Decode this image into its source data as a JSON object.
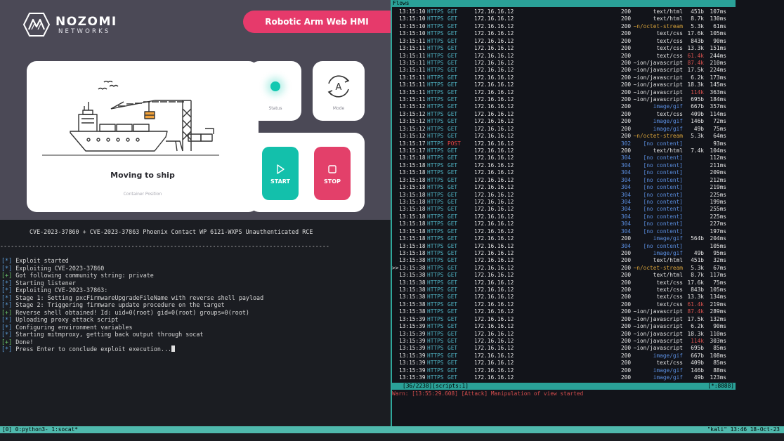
{
  "hmi": {
    "logo_name": "NOZOMI",
    "logo_sub": "NETWORKS",
    "title": "Robotic Arm Web HMI",
    "ship_state": "Moving to ship",
    "ship_sub": "Container Position",
    "status_label": "Status",
    "mode_label": "Mode",
    "mode_glyph": "A",
    "start_label": "START",
    "stop_label": "STOP",
    "accent": "#e63a6b",
    "status_color": "#13c8b1"
  },
  "terminal": {
    "banner": "CVE-2023-37860 + CVE-2023-37863 Phoenix Contact WP 6121-WXPS Unauthenticated RCE",
    "rule": "---------------------------------------------------------------------------------------------",
    "lines": [
      {
        "tag": "[*]",
        "text": "Exploit started",
        "ok": false
      },
      {
        "tag": "[*]",
        "text": "Exploiting CVE-2023-37860",
        "ok": false
      },
      {
        "tag": "[+]",
        "text": "Got following community string: private",
        "ok": true
      },
      {
        "tag": "[*]",
        "text": "Starting listener",
        "ok": false
      },
      {
        "tag": "[*]",
        "text": "Exploiting CVE-2023-37863:",
        "ok": false
      },
      {
        "tag": "[*]",
        "text": "Stage 1: Setting pxcFirmwareUpgradeFileName with reverse shell payload",
        "ok": false
      },
      {
        "tag": "[*]",
        "text": "Stage 2: Triggering firmware update procedure on the target",
        "ok": false
      },
      {
        "tag": "[+]",
        "text": "Reverse shell obtained! Id: uid=0(root) gid=0(root) groups=0(root)",
        "ok": true
      },
      {
        "tag": "[*]",
        "text": "Uploading proxy attack script",
        "ok": false
      },
      {
        "tag": "[*]",
        "text": "Configuring environment variables",
        "ok": false
      },
      {
        "tag": "[*]",
        "text": "Starting mitmproxy, getting back output through socat",
        "ok": false
      },
      {
        "tag": "[+]",
        "text": "Done!",
        "ok": true
      },
      {
        "tag": "[*]",
        "text": "Press Enter to conclude exploit execution...",
        "ok": false,
        "cursor": true
      }
    ]
  },
  "flows": {
    "header": "Flows",
    "rows": [
      {
        "cur": "",
        "time": "13:15:10",
        "proto": "HTTPS",
        "method": "GET",
        "ip": "172.16.16.12",
        "dir": "/awp/RoboticArmHMI/",
        "res": "RoboticArmH…",
        "code": "200",
        "type": "text/html",
        "size": "451b",
        "dur": "107ms"
      },
      {
        "cur": "",
        "time": "13:15:10",
        "proto": "HTTPS",
        "method": "GET",
        "ip": "172.16.16.12",
        "dir": "/Portal/",
        "res": "Portal.mwsl?PriNav=Awp",
        "code": "200",
        "type": "text/html",
        "size": "8.7k",
        "dur": "130ms"
      },
      {
        "cur": "",
        "time": "13:15:10",
        "proto": "HTTPS",
        "method": "GET",
        "ip": "172.16.16.12",
        "dir": "/",
        "res": "favicon.ico",
        "code": "200",
        "type": "~n/octet-stream",
        "tcolor": "orange",
        "size": "5.3k",
        "dur": "61ms"
      },
      {
        "cur": "",
        "time": "13:15:10",
        "proto": "HTTPS",
        "method": "GET",
        "ip": "172.16.16.12",
        "dir": "/CSS/",
        "res": "MiniWeb.css",
        "code": "200",
        "type": "text/css",
        "size": "17.6k",
        "dur": "105ms"
      },
      {
        "cur": "",
        "time": "13:15:11",
        "proto": "HTTPS",
        "method": "GET",
        "ip": "172.16.16.12",
        "dir": "/CSS/",
        "res": "TreeViewIcons.css",
        "code": "200",
        "type": "text/css",
        "size": "843b",
        "dur": "90ms"
      },
      {
        "cur": "",
        "time": "13:15:11",
        "proto": "HTTPS",
        "method": "GET",
        "ip": "172.16.16.12",
        "dir": "/CSS/",
        "res": "SpriteImages.css",
        "code": "200",
        "type": "text/css",
        "size": "13.3k",
        "dur": "151ms"
      },
      {
        "cur": "",
        "time": "13:15:11",
        "proto": "HTTPS",
        "method": "GET",
        "ip": "172.16.16.12",
        "dir": "/CSS/",
        "res": "S7Web.css",
        "code": "200",
        "type": "text/css",
        "size": "61.4k",
        "swarn": true,
        "dur": "244ms"
      },
      {
        "cur": "",
        "time": "13:15:11",
        "proto": "HTTPS",
        "method": "GET",
        "ip": "172.16.16.12",
        "dir": "/Scripts/",
        "res": "jquery.js",
        "code": "200",
        "type": "~ion/javascript",
        "size": "87.4k",
        "swarn": true,
        "dur": "210ms"
      },
      {
        "cur": "",
        "time": "13:15:11",
        "proto": "HTTPS",
        "method": "GET",
        "ip": "172.16.16.12",
        "dir": "/Scripts/",
        "res": "CommonScripts.js",
        "code": "200",
        "type": "~ion/javascript",
        "size": "17.5k",
        "dur": "224ms"
      },
      {
        "cur": "",
        "time": "13:15:11",
        "proto": "HTTPS",
        "method": "GET",
        "ip": "172.16.16.12",
        "dir": "/Scripts/",
        "res": "update.js",
        "code": "200",
        "type": "~ion/javascript",
        "size": "6.2k",
        "dur": "173ms"
      },
      {
        "cur": "",
        "time": "13:15:11",
        "proto": "HTTPS",
        "method": "GET",
        "ip": "172.16.16.12",
        "dir": "/Scripts/",
        "res": "sortfiltertablel.js",
        "code": "200",
        "type": "~ion/javascript",
        "size": "18.3k",
        "dur": "145ms"
      },
      {
        "cur": "",
        "time": "13:15:11",
        "proto": "HTTPS",
        "method": "GET",
        "ip": "172.16.16.12",
        "dir": "/Scripts/",
        "res": "topo.js",
        "code": "200",
        "type": "~ion/javascript",
        "size": "114k",
        "swarn": true,
        "dur": "363ms"
      },
      {
        "cur": "",
        "time": "13:15:11",
        "proto": "HTTPS",
        "method": "GET",
        "ip": "172.16.16.12",
        "dir": "/Scripts/",
        "res": "popup.js",
        "code": "200",
        "type": "~ion/javascript",
        "size": "695b",
        "dur": "184ms"
      },
      {
        "cur": "",
        "time": "13:15:12",
        "proto": "HTTPS",
        "method": "GET",
        "ip": "172.16.16.12",
        "dir": "/Images/",
        "res": "Siemens_Firmenmarke.gif",
        "code": "200",
        "type": "image/gif",
        "tcolor": "blue",
        "size": "667b",
        "dur": "357ms"
      },
      {
        "cur": "",
        "time": "13:15:12",
        "proto": "HTTPS",
        "method": "GET",
        "ip": "172.16.16.12",
        "dir": "/CSS/",
        "res": "MiniWebPrint.css",
        "code": "200",
        "type": "text/css",
        "size": "409b",
        "dur": "114ms"
      },
      {
        "cur": "",
        "time": "13:15:12",
        "proto": "HTTPS",
        "method": "GET",
        "ip": "172.16.16.12",
        "dir": "/Images/",
        "res": "background.gif",
        "code": "200",
        "type": "image/gif",
        "tcolor": "blue",
        "size": "146b",
        "dur": "72ms"
      },
      {
        "cur": "",
        "time": "13:15:12",
        "proto": "HTTPS",
        "method": "GET",
        "ip": "172.16.16.12",
        "dir": "/Images/",
        "res": "NaviPfeilweiss.gif",
        "code": "200",
        "type": "image/gif",
        "tcolor": "blue",
        "size": "49b",
        "dur": "75ms"
      },
      {
        "cur": "",
        "time": "13:15:12",
        "proto": "HTTPS",
        "method": "GET",
        "ip": "172.16.16.12",
        "dir": "/",
        "res": "favicon.ico",
        "code": "200",
        "type": "~n/octet-stream",
        "tcolor": "orange",
        "size": "5.3k",
        "dur": "64ms"
      },
      {
        "cur": "",
        "time": "13:15:17",
        "proto": "HTTPS",
        "method": "POST",
        "post": true,
        "ip": "172.16.16.12",
        "dir": "/FormLogin",
        "res": "",
        "code": "302",
        "cnc": true,
        "type": "[no content]",
        "tcolor": "blue",
        "size": "",
        "dur": "93ms"
      },
      {
        "cur": "",
        "time": "13:15:17",
        "proto": "HTTPS",
        "method": "GET",
        "ip": "172.16.16.12",
        "dir": "/Portal/",
        "res": "Portal.mwsl?PriNav=Awp",
        "code": "200",
        "type": "text/html",
        "size": "7.4k",
        "dur": "104ms"
      },
      {
        "cur": "",
        "time": "13:15:18",
        "proto": "HTTPS",
        "method": "GET",
        "ip": "172.16.16.12",
        "dir": "/CSS/",
        "res": "MiniWeb.css",
        "code": "304",
        "cnc": true,
        "type": "[no content]",
        "tcolor": "blue",
        "size": "",
        "dur": "112ms"
      },
      {
        "cur": "",
        "time": "13:15:18",
        "proto": "HTTPS",
        "method": "GET",
        "ip": "172.16.16.12",
        "dir": "/CSS/",
        "res": "TreeViewIcons.css",
        "code": "304",
        "cnc": true,
        "type": "[no content]",
        "tcolor": "blue",
        "size": "",
        "dur": "211ms"
      },
      {
        "cur": "",
        "time": "13:15:18",
        "proto": "HTTPS",
        "method": "GET",
        "ip": "172.16.16.12",
        "dir": "/CSS/",
        "res": "SpriteImages.css",
        "code": "304",
        "cnc": true,
        "type": "[no content]",
        "tcolor": "blue",
        "size": "",
        "dur": "209ms"
      },
      {
        "cur": "",
        "time": "13:15:18",
        "proto": "HTTPS",
        "method": "GET",
        "ip": "172.16.16.12",
        "dir": "/CSS/",
        "res": "S7Web.css",
        "code": "304",
        "cnc": true,
        "type": "[no content]",
        "tcolor": "blue",
        "size": "",
        "dur": "212ms"
      },
      {
        "cur": "",
        "time": "13:15:18",
        "proto": "HTTPS",
        "method": "GET",
        "ip": "172.16.16.12",
        "dir": "/Scripts/",
        "res": "jquery.js",
        "code": "304",
        "cnc": true,
        "type": "[no content]",
        "tcolor": "blue",
        "size": "",
        "dur": "219ms"
      },
      {
        "cur": "",
        "time": "13:15:18",
        "proto": "HTTPS",
        "method": "GET",
        "ip": "172.16.16.12",
        "dir": "/Scripts/",
        "res": "CommonScripts.js",
        "code": "304",
        "cnc": true,
        "type": "[no content]",
        "tcolor": "blue",
        "size": "",
        "dur": "225ms"
      },
      {
        "cur": "",
        "time": "13:15:18",
        "proto": "HTTPS",
        "method": "GET",
        "ip": "172.16.16.12",
        "dir": "/Scripts/",
        "res": "update.js",
        "code": "304",
        "cnc": true,
        "type": "[no content]",
        "tcolor": "blue",
        "size": "",
        "dur": "199ms"
      },
      {
        "cur": "",
        "time": "13:15:18",
        "proto": "HTTPS",
        "method": "GET",
        "ip": "172.16.16.12",
        "dir": "/Scripts/",
        "res": "sortfiltertablel.js",
        "code": "304",
        "cnc": true,
        "type": "[no content]",
        "tcolor": "blue",
        "size": "",
        "dur": "255ms"
      },
      {
        "cur": "",
        "time": "13:15:18",
        "proto": "HTTPS",
        "method": "GET",
        "ip": "172.16.16.12",
        "dir": "/Scripts/",
        "res": "topo.js",
        "code": "304",
        "cnc": true,
        "type": "[no content]",
        "tcolor": "blue",
        "size": "",
        "dur": "225ms"
      },
      {
        "cur": "",
        "time": "13:15:18",
        "proto": "HTTPS",
        "method": "GET",
        "ip": "172.16.16.12",
        "dir": "/Scripts/",
        "res": "popup.js",
        "code": "304",
        "cnc": true,
        "type": "[no content]",
        "tcolor": "blue",
        "size": "",
        "dur": "227ms"
      },
      {
        "cur": "",
        "time": "13:15:18",
        "proto": "HTTPS",
        "method": "GET",
        "ip": "172.16.16.12",
        "dir": "/Images/",
        "res": "Siemens_Firmenmarke.gif",
        "code": "304",
        "cnc": true,
        "type": "[no content]",
        "tcolor": "blue",
        "size": "",
        "dur": "197ms"
      },
      {
        "cur": "",
        "time": "13:15:18",
        "proto": "HTTPS",
        "method": "GET",
        "ip": "172.16.16.12",
        "dir": "/Images/",
        "res": "ICO_WEB_refresh.gif",
        "code": "200",
        "type": "image/gif",
        "tcolor": "blue",
        "size": "564b",
        "dur": "204ms"
      },
      {
        "cur": "",
        "time": "13:15:18",
        "proto": "HTTPS",
        "method": "GET",
        "ip": "172.16.16.12",
        "dir": "/CSS/",
        "res": "MiniWebPrint.css",
        "code": "304",
        "cnc": true,
        "type": "[no content]",
        "tcolor": "blue",
        "size": "",
        "dur": "105ms"
      },
      {
        "cur": "",
        "time": "13:15:18",
        "proto": "HTTPS",
        "method": "GET",
        "ip": "172.16.16.12",
        "dir": "/Images/",
        "res": "NaviPfeilblau.gif",
        "code": "200",
        "type": "image/gif",
        "tcolor": "blue",
        "size": "49b",
        "dur": "95ms"
      },
      {
        "cur": "",
        "time": "13:15:38",
        "proto": "HTTPS",
        "method": "GET",
        "ip": "172.16.16.12",
        "dir": "/awp/RoboticArmHMI/",
        "res": "RoboticArmH…",
        "code": "200",
        "type": "text/html",
        "size": "451b",
        "dur": "32ms"
      },
      {
        "cur": ">>",
        "time": "13:15:38",
        "proto": "HTTPS",
        "method": "GET",
        "ip": "172.16.16.12",
        "dir": "/",
        "res": "favicon.ico",
        "code": "200",
        "type": "~n/octet-stream",
        "tcolor": "orange",
        "size": "5.3k",
        "dur": "67ms"
      },
      {
        "cur": "",
        "time": "13:15:38",
        "proto": "HTTPS",
        "method": "GET",
        "ip": "172.16.16.12",
        "dir": "/Portal/",
        "res": "Portal.mwsl?PriNav=Awp",
        "code": "200",
        "type": "text/html",
        "size": "8.7k",
        "dur": "117ms"
      },
      {
        "cur": "",
        "time": "13:15:38",
        "proto": "HTTPS",
        "method": "GET",
        "ip": "172.16.16.12",
        "dir": "/CSS/",
        "res": "MiniWeb.css",
        "code": "200",
        "type": "text/css",
        "size": "17.6k",
        "dur": "75ms"
      },
      {
        "cur": "",
        "time": "13:15:38",
        "proto": "HTTPS",
        "method": "GET",
        "ip": "172.16.16.12",
        "dir": "/CSS/",
        "res": "TreeViewIcons.css",
        "code": "200",
        "type": "text/css",
        "size": "843b",
        "dur": "105ms"
      },
      {
        "cur": "",
        "time": "13:15:38",
        "proto": "HTTPS",
        "method": "GET",
        "ip": "172.16.16.12",
        "dir": "/CSS/",
        "res": "SpriteImages.css",
        "code": "200",
        "type": "text/css",
        "size": "13.3k",
        "dur": "134ms"
      },
      {
        "cur": "",
        "time": "13:15:38",
        "proto": "HTTPS",
        "method": "GET",
        "ip": "172.16.16.12",
        "dir": "/CSS/",
        "res": "S7Web.css",
        "code": "200",
        "type": "text/css",
        "size": "61.4k",
        "swarn": true,
        "dur": "219ms"
      },
      {
        "cur": "",
        "time": "13:15:38",
        "proto": "HTTPS",
        "method": "GET",
        "ip": "172.16.16.12",
        "dir": "/Scripts/",
        "res": "jquery.js",
        "code": "200",
        "type": "~ion/javascript",
        "size": "87.4k",
        "swarn": true,
        "dur": "289ms"
      },
      {
        "cur": "",
        "time": "13:15:39",
        "proto": "HTTPS",
        "method": "GET",
        "ip": "172.16.16.12",
        "dir": "/Scripts/",
        "res": "CommonScripts.js",
        "code": "200",
        "type": "~ion/javascript",
        "size": "17.5k",
        "dur": "132ms"
      },
      {
        "cur": "",
        "time": "13:15:39",
        "proto": "HTTPS",
        "method": "GET",
        "ip": "172.16.16.12",
        "dir": "/Scripts/",
        "res": "update.js",
        "code": "200",
        "type": "~ion/javascript",
        "size": "6.2k",
        "dur": "90ms"
      },
      {
        "cur": "",
        "time": "13:15:39",
        "proto": "HTTPS",
        "method": "GET",
        "ip": "172.16.16.12",
        "dir": "/Scripts/",
        "res": "sortfiltertablel.js",
        "code": "200",
        "type": "~ion/javascript",
        "size": "18.3k",
        "dur": "110ms"
      },
      {
        "cur": "",
        "time": "13:15:39",
        "proto": "HTTPS",
        "method": "GET",
        "ip": "172.16.16.12",
        "dir": "/Scripts/",
        "res": "topo.js",
        "code": "200",
        "type": "~ion/javascript",
        "size": "114k",
        "swarn": true,
        "dur": "303ms"
      },
      {
        "cur": "",
        "time": "13:15:39",
        "proto": "HTTPS",
        "method": "GET",
        "ip": "172.16.16.12",
        "dir": "/Scripts/",
        "res": "popup.js",
        "code": "200",
        "type": "~ion/javascript",
        "size": "695b",
        "dur": "85ms"
      },
      {
        "cur": "",
        "time": "13:15:39",
        "proto": "HTTPS",
        "method": "GET",
        "ip": "172.16.16.12",
        "dir": "/Images/",
        "res": "Siemens_Firmenmarke.gif",
        "code": "200",
        "type": "image/gif",
        "tcolor": "blue",
        "size": "667b",
        "dur": "108ms"
      },
      {
        "cur": "",
        "time": "13:15:39",
        "proto": "HTTPS",
        "method": "GET",
        "ip": "172.16.16.12",
        "dir": "/CSS/",
        "res": "MiniWebPrint.css",
        "code": "200",
        "type": "text/css",
        "size": "409b",
        "dur": "85ms"
      },
      {
        "cur": "",
        "time": "13:15:39",
        "proto": "HTTPS",
        "method": "GET",
        "ip": "172.16.16.12",
        "dir": "/Images/",
        "res": "background.gif",
        "code": "200",
        "type": "image/gif",
        "tcolor": "blue",
        "size": "146b",
        "dur": "88ms"
      },
      {
        "cur": "",
        "time": "13:15:39",
        "proto": "HTTPS",
        "method": "GET",
        "ip": "172.16.16.12",
        "dir": "/Images/",
        "res": "NaviPfeilweiss.gif",
        "code": "200",
        "type": "image/gif",
        "tcolor": "blue",
        "size": "49b",
        "dur": "123ms"
      }
    ],
    "status_left": "[36/2238][scripts:1]",
    "status_right": "[*:8888]",
    "warning": "Warn: [13:55:29.608] [Attack] Manipulation of view started"
  },
  "tmux": {
    "left": "[0] 0:python3- 1:socat*",
    "right": "\"kali\" 13:46 18-Oct-23"
  },
  "colors": {
    "accent": "#e63a6b",
    "teal": "#2aa198",
    "start": "#13c0ab",
    "stop": "#e3406a",
    "warning": "#d44c4c"
  }
}
